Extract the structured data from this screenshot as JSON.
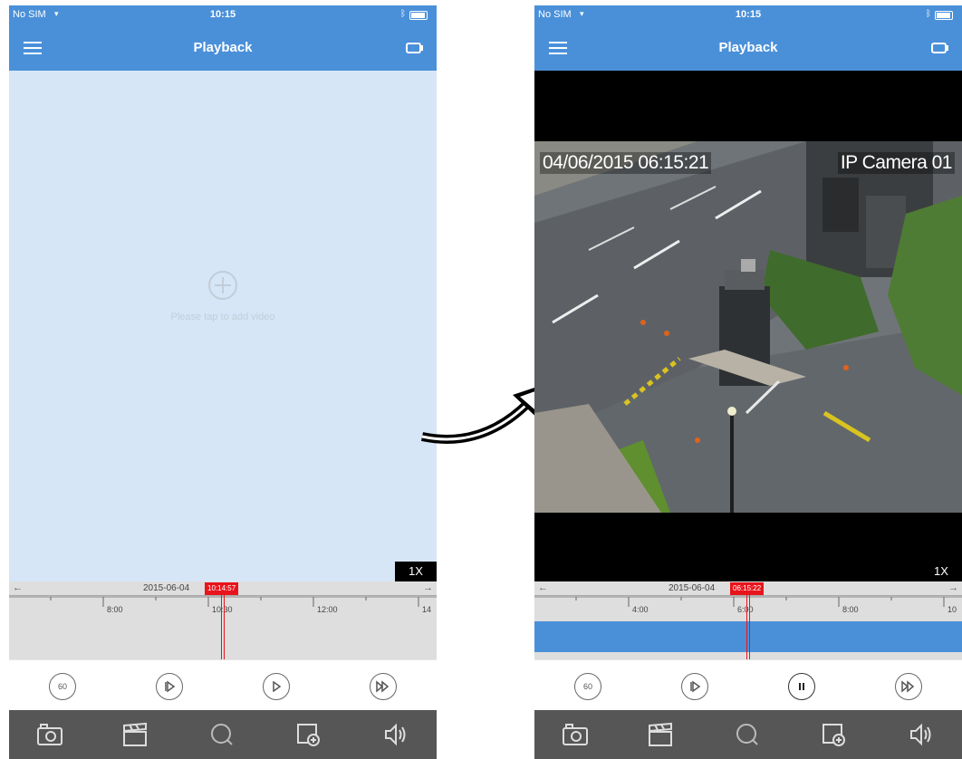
{
  "status_bar": {
    "carrier": "No SIM",
    "time": "10:15"
  },
  "nav": {
    "title": "Playback",
    "menu_icon": "hamburger-menu-icon",
    "camera_icon": "camera-switch-icon"
  },
  "left_screen": {
    "add_video_hint": "Please tap to add video",
    "speed": "1X",
    "timeline": {
      "date": "2015-06-04",
      "current_time": "10:14:57",
      "tick_labels": [
        "8:00",
        "10:30",
        "12:00",
        "14"
      ]
    }
  },
  "right_screen": {
    "osd_timestamp": "04/06/2015 06:15:21",
    "osd_camera": "IP Camera 01",
    "speed": "1X",
    "timeline": {
      "date": "2015-06-04",
      "current_time": "06:15:22",
      "tick_labels": [
        "4:00",
        "6:00",
        "8:00",
        "10"
      ]
    }
  },
  "controls": {
    "rewind_label": "60",
    "icons": [
      "rewind-60-icon",
      "slow-play-icon",
      "play-pause-icon",
      "fast-forward-icon"
    ]
  },
  "toolbar": {
    "icons": [
      "camera-snapshot-icon",
      "clapperboard-record-icon",
      "search-icon",
      "add-screen-icon",
      "speaker-icon"
    ]
  },
  "colors": {
    "header_blue": "#4a90d9",
    "timeline_red": "#e8141c",
    "toolbar_gray": "#565656",
    "empty_video_bg": "#d6e6f7"
  }
}
